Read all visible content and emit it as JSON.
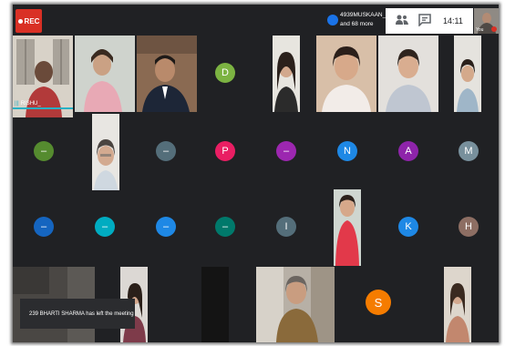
{
  "recording": {
    "label": "REC"
  },
  "meeting": {
    "participants_line1": "4939MUSKAAN_",
    "participants_line2": "and 68 more",
    "time": "14:11",
    "self_label": "You"
  },
  "speaker": {
    "name": "RISHU_"
  },
  "avatars": {
    "row1_d": {
      "initial": "D",
      "color": "#7cb342"
    },
    "row2_1": {
      "initial": "–",
      "color": "#558b2f"
    },
    "row2_3": {
      "initial": "–",
      "color": "#546e7a"
    },
    "row2_4": {
      "initial": "P",
      "color": "#e91e63"
    },
    "row2_5": {
      "initial": "–",
      "color": "#9c27b0"
    },
    "row2_6": {
      "initial": "N",
      "color": "#1e88e5"
    },
    "row2_7": {
      "initial": "A",
      "color": "#8e24aa"
    },
    "row2_8": {
      "initial": "M",
      "color": "#78909c"
    },
    "row3_1": {
      "initial": "–",
      "color": "#1565c0"
    },
    "row3_2": {
      "initial": "–",
      "color": "#00acc1"
    },
    "row3_3": {
      "initial": "–",
      "color": "#1e88e5"
    },
    "row3_4": {
      "initial": "–",
      "color": "#00796b"
    },
    "row3_5": {
      "initial": "I",
      "color": "#546e7a"
    },
    "row3_7": {
      "initial": "K",
      "color": "#1e88e5"
    },
    "row3_8": {
      "initial": "H",
      "color": "#8d6e63"
    },
    "row4_s": {
      "initial": "S",
      "color": "#f57c00"
    }
  },
  "notification": {
    "text": "239 BHARTI SHARMA has left the meeting"
  }
}
